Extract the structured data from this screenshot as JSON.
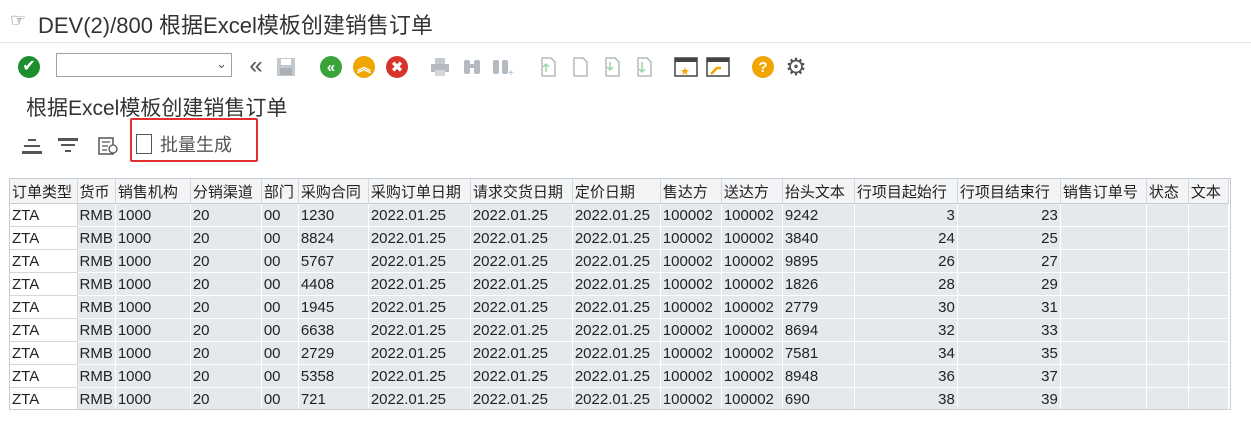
{
  "window": {
    "title": "DEV(2)/800 根据Excel模板创建销售订单"
  },
  "toolbar": {
    "command_value": "",
    "command_placeholder": "",
    "icons": [
      "enter-icon",
      "back-double-icon",
      "save-icon",
      "back-icon",
      "exit-icon",
      "cancel-icon",
      "print-icon",
      "find-icon",
      "find-next-icon",
      "first-page-icon",
      "prev-page-icon",
      "next-page-icon",
      "last-page-icon",
      "new-session-icon",
      "shortcut-icon",
      "help-icon",
      "settings-gear-icon"
    ],
    "colors": {
      "enter": "#1e8f2e",
      "back": "#3aa43a",
      "exit": "#f0a500",
      "cancel": "#d9342b",
      "help": "#f0a500"
    }
  },
  "page": {
    "subtitle": "根据Excel模板创建销售订单"
  },
  "app_toolbar": {
    "mass_generate_label": "批量生成"
  },
  "table": {
    "headers": [
      "订单类型",
      "货币",
      "销售机构",
      "分销渠道",
      "部门",
      "采购合同",
      "采购订单日期",
      "请求交货日期",
      "定价日期",
      "售达方",
      "送达方",
      "抬头文本",
      "行项目起始行",
      "行项目结束行",
      "销售订单号",
      "状态",
      "文本"
    ],
    "rows": [
      [
        "ZTA",
        "RMB",
        "1000",
        "20",
        "00",
        "1230",
        "2022.01.25",
        "2022.01.25",
        "2022.01.25",
        "100002",
        "100002",
        "9242",
        "3",
        "23",
        "",
        "",
        ""
      ],
      [
        "ZTA",
        "RMB",
        "1000",
        "20",
        "00",
        "8824",
        "2022.01.25",
        "2022.01.25",
        "2022.01.25",
        "100002",
        "100002",
        "3840",
        "24",
        "25",
        "",
        "",
        ""
      ],
      [
        "ZTA",
        "RMB",
        "1000",
        "20",
        "00",
        "5767",
        "2022.01.25",
        "2022.01.25",
        "2022.01.25",
        "100002",
        "100002",
        "9895",
        "26",
        "27",
        "",
        "",
        ""
      ],
      [
        "ZTA",
        "RMB",
        "1000",
        "20",
        "00",
        "4408",
        "2022.01.25",
        "2022.01.25",
        "2022.01.25",
        "100002",
        "100002",
        "1826",
        "28",
        "29",
        "",
        "",
        ""
      ],
      [
        "ZTA",
        "RMB",
        "1000",
        "20",
        "00",
        "1945",
        "2022.01.25",
        "2022.01.25",
        "2022.01.25",
        "100002",
        "100002",
        "2779",
        "30",
        "31",
        "",
        "",
        ""
      ],
      [
        "ZTA",
        "RMB",
        "1000",
        "20",
        "00",
        "6638",
        "2022.01.25",
        "2022.01.25",
        "2022.01.25",
        "100002",
        "100002",
        "8694",
        "32",
        "33",
        "",
        "",
        ""
      ],
      [
        "ZTA",
        "RMB",
        "1000",
        "20",
        "00",
        "2729",
        "2022.01.25",
        "2022.01.25",
        "2022.01.25",
        "100002",
        "100002",
        "7581",
        "34",
        "35",
        "",
        "",
        ""
      ],
      [
        "ZTA",
        "RMB",
        "1000",
        "20",
        "00",
        "5358",
        "2022.01.25",
        "2022.01.25",
        "2022.01.25",
        "100002",
        "100002",
        "8948",
        "36",
        "37",
        "",
        "",
        ""
      ],
      [
        "ZTA",
        "RMB",
        "1000",
        "20",
        "00",
        "721",
        "2022.01.25",
        "2022.01.25",
        "2022.01.25",
        "100002",
        "100002",
        "690",
        "38",
        "39",
        "",
        "",
        ""
      ]
    ]
  }
}
